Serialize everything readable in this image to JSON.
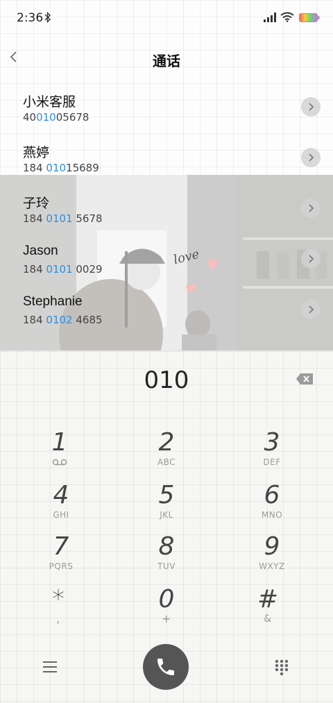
{
  "status_bar": {
    "time": "2:36"
  },
  "header": {
    "title": "通话"
  },
  "contacts": [
    {
      "name": "小米客服",
      "number_pre": "40",
      "number_match": "010",
      "number_post": "05678"
    },
    {
      "name": "燕婷",
      "number_pre": "184 ",
      "number_match": "010",
      "number_post": "15689"
    },
    {
      "name": "子玲",
      "number_pre": "184 ",
      "number_match": "0101",
      "number_post": " 5678"
    },
    {
      "name": "Jason",
      "number_pre": "184 ",
      "number_match": "0101",
      "number_post": " 0029"
    },
    {
      "name": "Stephanie",
      "number_pre": "184 ",
      "number_match": "0102",
      "number_post": " 4685"
    }
  ],
  "photo_overlay_text": "love",
  "dialpad": {
    "input": "010",
    "keys": [
      {
        "digit": "1",
        "letters": ""
      },
      {
        "digit": "2",
        "letters": "ABC"
      },
      {
        "digit": "3",
        "letters": "DEF"
      },
      {
        "digit": "4",
        "letters": "GHI"
      },
      {
        "digit": "5",
        "letters": "JKL"
      },
      {
        "digit": "6",
        "letters": "MNO"
      },
      {
        "digit": "7",
        "letters": "PQRS"
      },
      {
        "digit": "8",
        "letters": "TUV"
      },
      {
        "digit": "9",
        "letters": "WXYZ"
      },
      {
        "digit": "*",
        "letters": ","
      },
      {
        "digit": "0",
        "letters": "+"
      },
      {
        "digit": "#",
        "letters": "&"
      }
    ]
  },
  "icons": {
    "bluetooth": "bluetooth-icon",
    "signal": "signal-icon",
    "wifi": "wifi-icon",
    "battery": "battery-icon",
    "back": "back-icon",
    "arrow": "chevron-right-icon",
    "backspace": "backspace-icon",
    "voicemail": "voicemail-icon",
    "menu": "menu-icon",
    "call": "phone-icon",
    "keypad": "keypad-icon"
  },
  "colors": {
    "match_highlight": "#2b8fe0",
    "call_button": "#555555"
  }
}
